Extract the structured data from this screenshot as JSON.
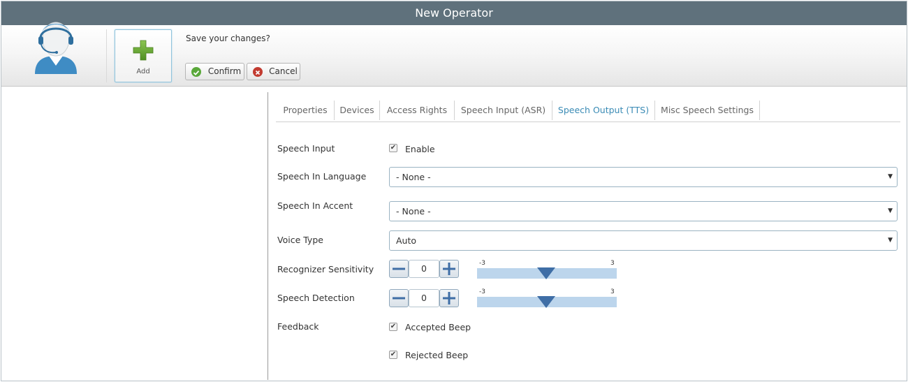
{
  "window": {
    "title": "New Operator"
  },
  "toolbar": {
    "add_label": "Add",
    "prompt": "Save your changes?",
    "confirm_label": "Confirm",
    "cancel_label": "Cancel"
  },
  "tabs": [
    {
      "label": "Properties",
      "active": false
    },
    {
      "label": "Devices",
      "active": false
    },
    {
      "label": "Access Rights",
      "active": false
    },
    {
      "label": "Speech Input (ASR)",
      "active": false
    },
    {
      "label": "Speech Output (TTS)",
      "active": true
    },
    {
      "label": "Misc Speech Settings",
      "active": false
    }
  ],
  "form": {
    "speech_input": {
      "label": "Speech Input",
      "checkbox_label": "Enable",
      "checked": true
    },
    "speech_language": {
      "label": "Speech In Language",
      "value": "- None -"
    },
    "speech_accent": {
      "label": "Speech In Accent",
      "value": "- None -"
    },
    "voice_type": {
      "label": "Voice Type",
      "value": "Auto"
    },
    "recognizer_sensitivity": {
      "label": "Recognizer Sensitivity",
      "value": "0",
      "min": "-3",
      "max": "3"
    },
    "speech_detection": {
      "label": "Speech Detection",
      "value": "0",
      "min": "-3",
      "max": "3"
    },
    "feedback": {
      "label": "Feedback",
      "accepted_label": "Accepted Beep",
      "accepted_checked": true,
      "rejected_label": "Rejected Beep",
      "rejected_checked": true
    }
  },
  "colors": {
    "titlebar": "#5f717c",
    "active_tab": "#3a8bb5",
    "slider_track": "#bcd5ec",
    "slider_handle": "#3f6ea6",
    "add_icon": "#6aa433",
    "confirm_icon": "#5aa83a",
    "cancel_icon": "#c23b30"
  },
  "icons": {
    "avatar": "operator-headset-avatar",
    "add": "plus-icon",
    "confirm": "check-circle-icon",
    "cancel": "x-circle-icon",
    "dropdown": "caret-down-icon",
    "minus": "minus-icon",
    "plus": "plus-icon",
    "slider": "slider-handle-icon"
  }
}
